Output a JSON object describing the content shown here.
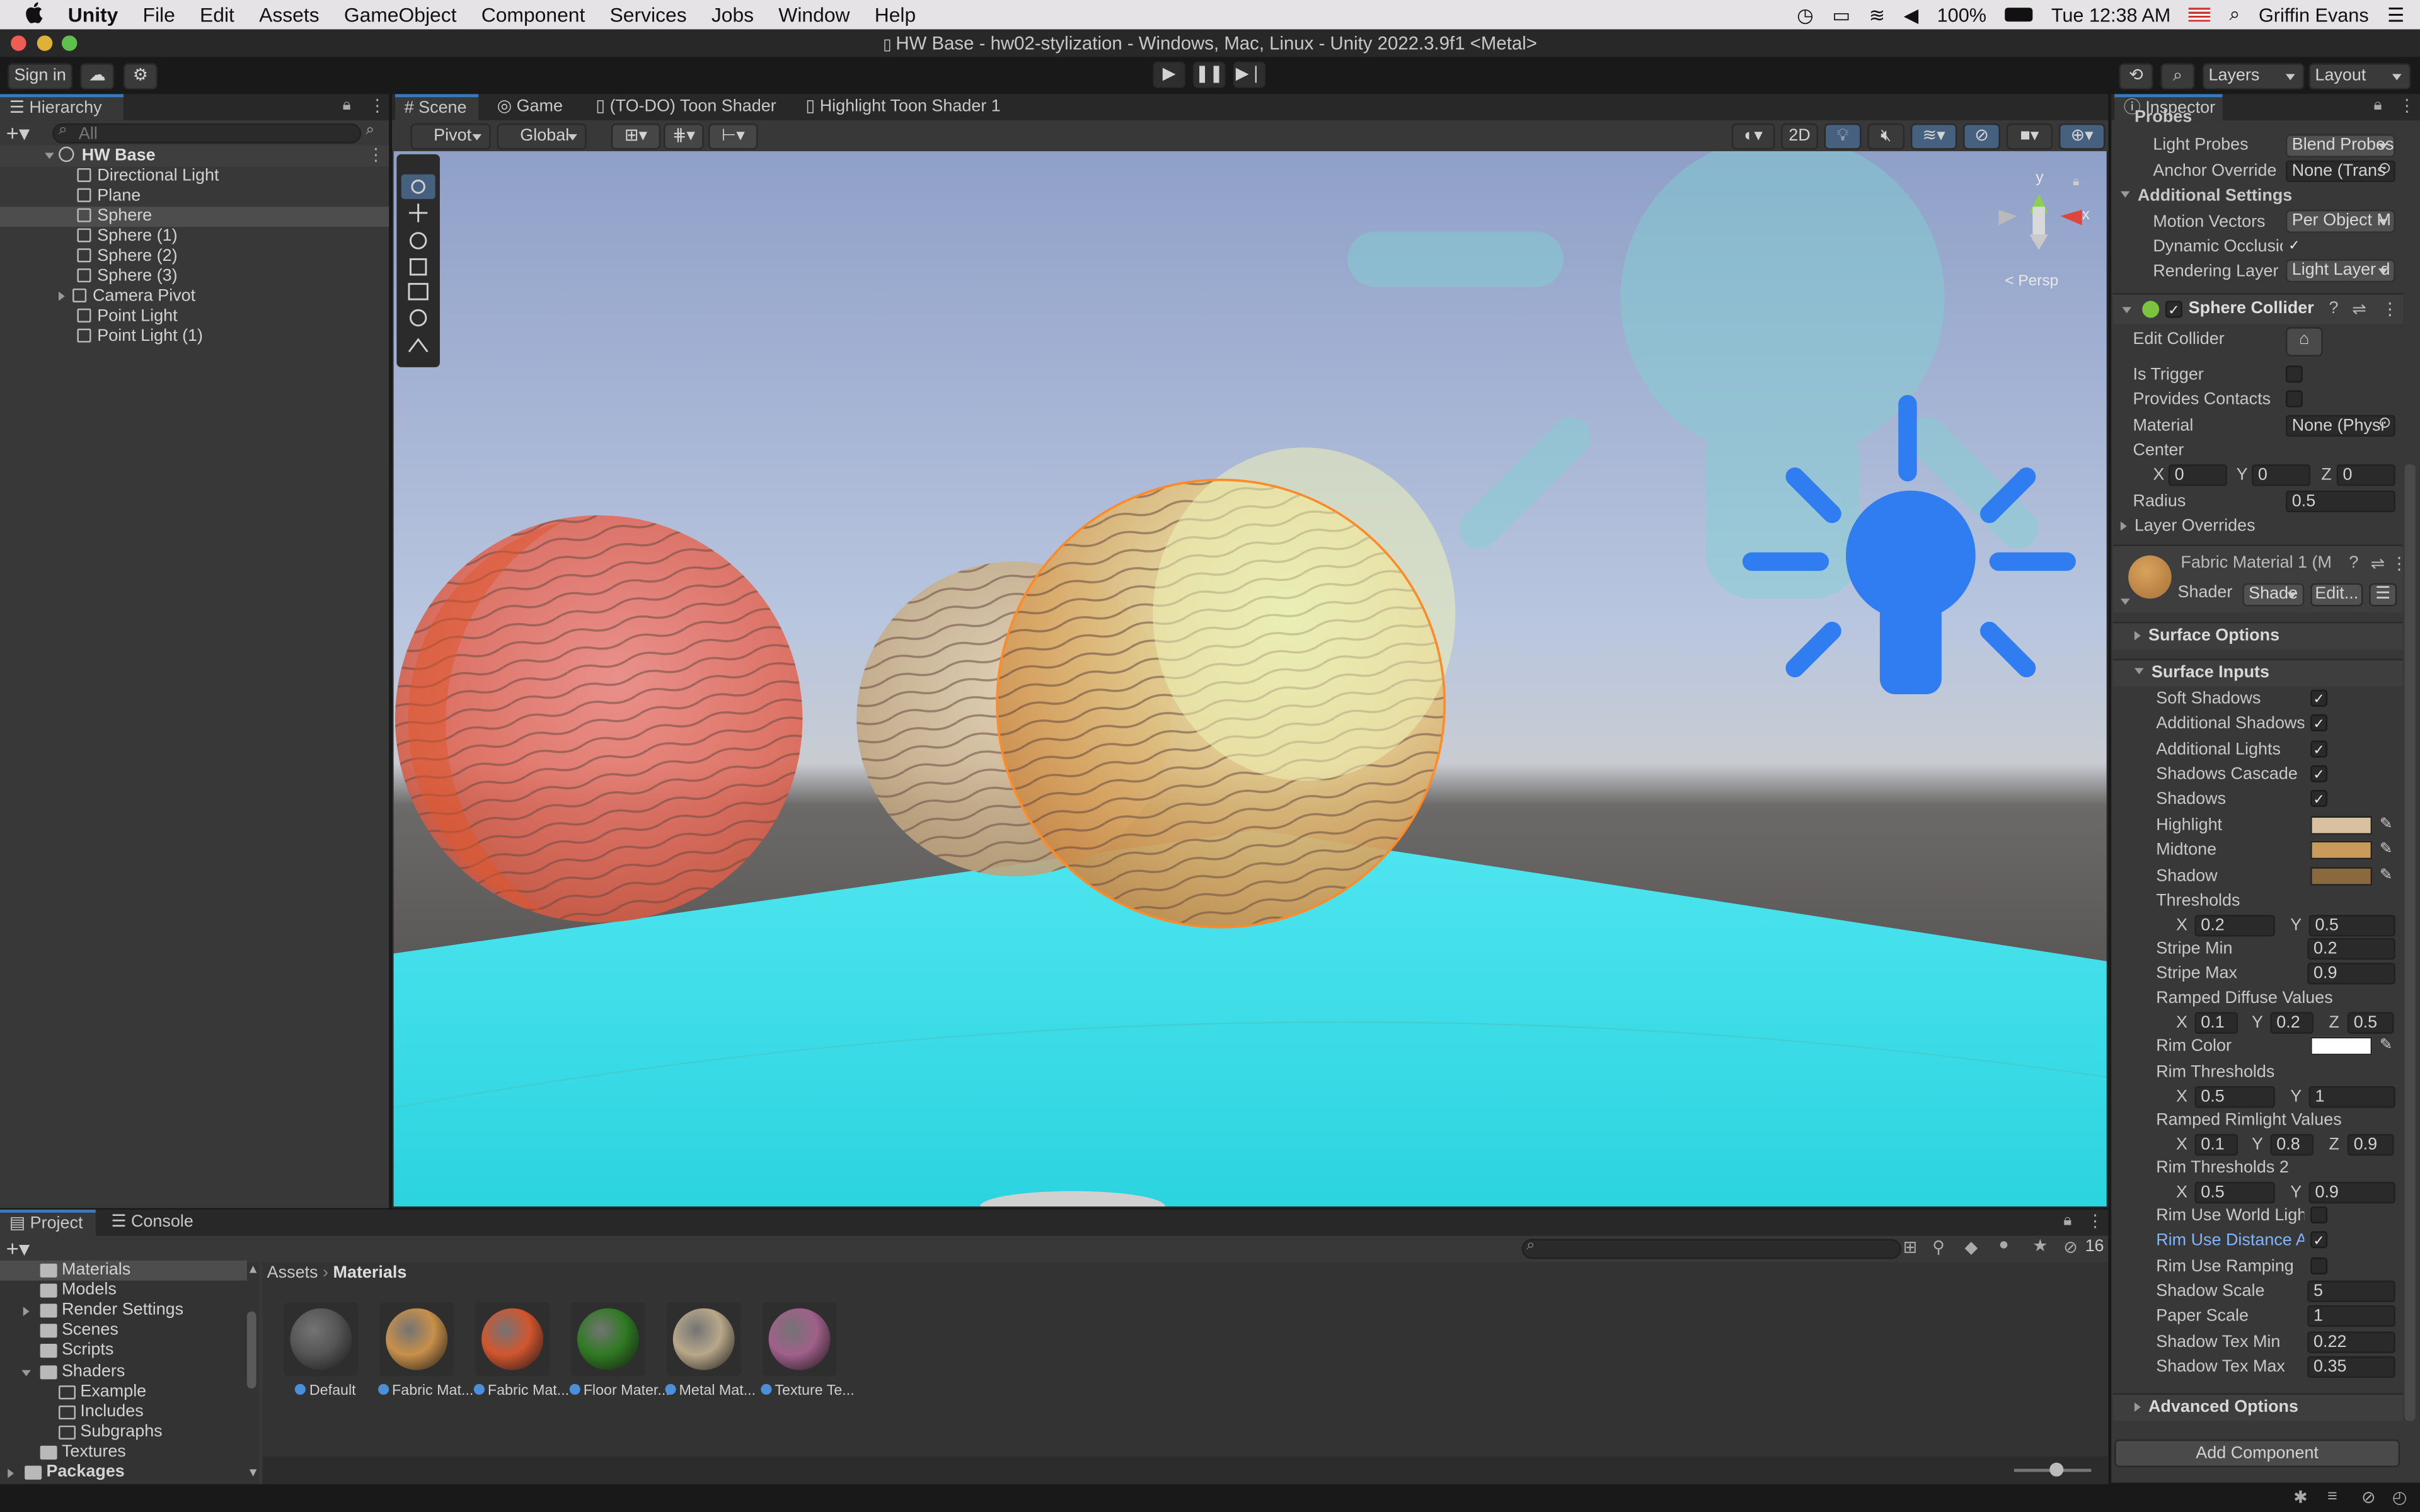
{
  "menubar": {
    "apple": "",
    "app": "Unity",
    "items": [
      "File",
      "Edit",
      "Assets",
      "GameObject",
      "Component",
      "Services",
      "Jobs",
      "Window",
      "Help"
    ],
    "battery": "100%",
    "clock": "Tue 12:38 AM",
    "user": "Griffin Evans"
  },
  "window": {
    "title": "HW Base - hw02-stylization - Windows, Mac, Linux - Unity 2022.3.9f1 <Metal>"
  },
  "toolbar": {
    "sign_in": "Sign in",
    "layers": "Layers",
    "layout": "Layout"
  },
  "hierarchy": {
    "tab": "Hierarchy",
    "search_placeholder": "All",
    "scene": "HW Base",
    "items": [
      "Directional Light",
      "Plane",
      "Sphere",
      "Sphere (1)",
      "Sphere (2)",
      "Sphere (3)",
      "Camera Pivot",
      "Point Light",
      "Point Light (1)"
    ],
    "selected_index": 2
  },
  "scene_tabs": [
    "Scene",
    "Game",
    "(TO-DO) Toon Shader",
    "Highlight Toon Shader 1"
  ],
  "scene_toolbar": {
    "pivot": "Pivot",
    "global": "Global",
    "mode2d": "2D"
  },
  "gizmo": {
    "y": "y",
    "x": "x",
    "persp": "< Persp"
  },
  "inspector": {
    "tab": "Inspector",
    "probes": {
      "section": "Probes",
      "light_probes_label": "Light Probes",
      "light_probes_value": "Blend Probes",
      "anchor_override_label": "Anchor Override",
      "anchor_override_value": "None (Trans"
    },
    "additional": {
      "section": "Additional Settings",
      "motion_vectors_label": "Motion Vectors",
      "motion_vectors_value": "Per Object M",
      "dynamic_occlusion_label": "Dynamic Occlusion",
      "rendering_layer_label": "Rendering Layer M",
      "rendering_layer_value": "Light Layer d"
    },
    "collider": {
      "title": "Sphere Collider",
      "edit_collider": "Edit Collider",
      "is_trigger": "Is Trigger",
      "provides_contacts": "Provides Contacts",
      "material_label": "Material",
      "material_value": "None (Physi",
      "center_label": "Center",
      "center": {
        "x": "0",
        "y": "0",
        "z": "0"
      },
      "radius_label": "Radius",
      "radius": "0.5",
      "layer_overrides": "Layer Overrides"
    },
    "material": {
      "name": "Fabric Material 1 (M",
      "shader_label": "Shader",
      "shader_value": "Shade",
      "edit": "Edit..."
    },
    "surface_options": "Surface Options",
    "surface_inputs": {
      "section": "Surface Inputs",
      "soft_shadows": "Soft Shadows",
      "additional_shadows": "Additional Shadows",
      "additional_lights": "Additional Lights",
      "shadows_cascade": "Shadows Cascade",
      "shadows": "Shadows",
      "highlight": "Highlight",
      "midtone": "Midtone",
      "shadow": "Shadow",
      "thresholds_label": "Thresholds",
      "thresholds": {
        "x": "0.2",
        "y": "0.5"
      },
      "stripe_min_label": "Stripe Min",
      "stripe_min": "0.2",
      "stripe_max_label": "Stripe Max",
      "stripe_max": "0.9",
      "ramped_diffuse_label": "Ramped Diffuse Values",
      "ramped_diffuse": {
        "x": "0.1",
        "y": "0.2",
        "z": "0.5"
      },
      "rim_color": "Rim Color",
      "rim_thresholds_label": "Rim Thresholds",
      "rim_thresholds": {
        "x": "0.5",
        "y": "1"
      },
      "ramped_rim_label": "Ramped Rimlight Values",
      "ramped_rim": {
        "x": "0.1",
        "y": "0.8",
        "z": "0.9"
      },
      "rim_thresholds2_label": "Rim Thresholds 2",
      "rim_thresholds2": {
        "x": "0.5",
        "y": "0.9"
      },
      "rim_world_light": "Rim Use World Light",
      "rim_distance": "Rim Use Distance Att",
      "rim_ramping": "Rim Use Ramping",
      "shadow_scale_label": "Shadow Scale",
      "shadow_scale": "5",
      "paper_scale_label": "Paper Scale",
      "paper_scale": "1",
      "shadow_tex_min_label": "Shadow Tex Min",
      "shadow_tex_min": "0.22",
      "shadow_tex_max_label": "Shadow Tex Max",
      "shadow_tex_max": "0.35"
    },
    "advanced": "Advanced Options",
    "add_component": "Add Component",
    "colors": {
      "highlight": "#d9c1a0",
      "midtone": "#c89a5c",
      "shadow": "#8a6a3c",
      "rim": "#ffffff"
    }
  },
  "project": {
    "tabs": [
      "Project",
      "Console"
    ],
    "hidden_count": "16",
    "tree": [
      {
        "label": "Materials",
        "indent": 0,
        "fold": "none",
        "selected": true
      },
      {
        "label": "Models",
        "indent": 0,
        "fold": "none"
      },
      {
        "label": "Render Settings",
        "indent": 0,
        "fold": "right"
      },
      {
        "label": "Scenes",
        "indent": 0,
        "fold": "none"
      },
      {
        "label": "Scripts",
        "indent": 0,
        "fold": "none"
      },
      {
        "label": "Shaders",
        "indent": 0,
        "fold": "down"
      },
      {
        "label": "Example",
        "indent": 1,
        "fold": "none"
      },
      {
        "label": "Includes",
        "indent": 1,
        "fold": "none"
      },
      {
        "label": "Subgraphs",
        "indent": 1,
        "fold": "none"
      },
      {
        "label": "Textures",
        "indent": 0,
        "fold": "none"
      },
      {
        "label": "Packages",
        "indent": -1,
        "fold": "right",
        "bold": true
      }
    ],
    "breadcrumb": [
      "Assets",
      "Materials"
    ],
    "assets": [
      {
        "label": "Default",
        "color": "#555555"
      },
      {
        "label": "Fabric Mat...",
        "color": "#c8904a"
      },
      {
        "label": "Fabric Mat...",
        "color": "#d2562e"
      },
      {
        "label": "Floor Mater...",
        "color": "#2f7a22"
      },
      {
        "label": "Metal Mat...",
        "color": "#b8a88a"
      },
      {
        "label": "Texture Te...",
        "color": "#a0608a"
      }
    ]
  }
}
